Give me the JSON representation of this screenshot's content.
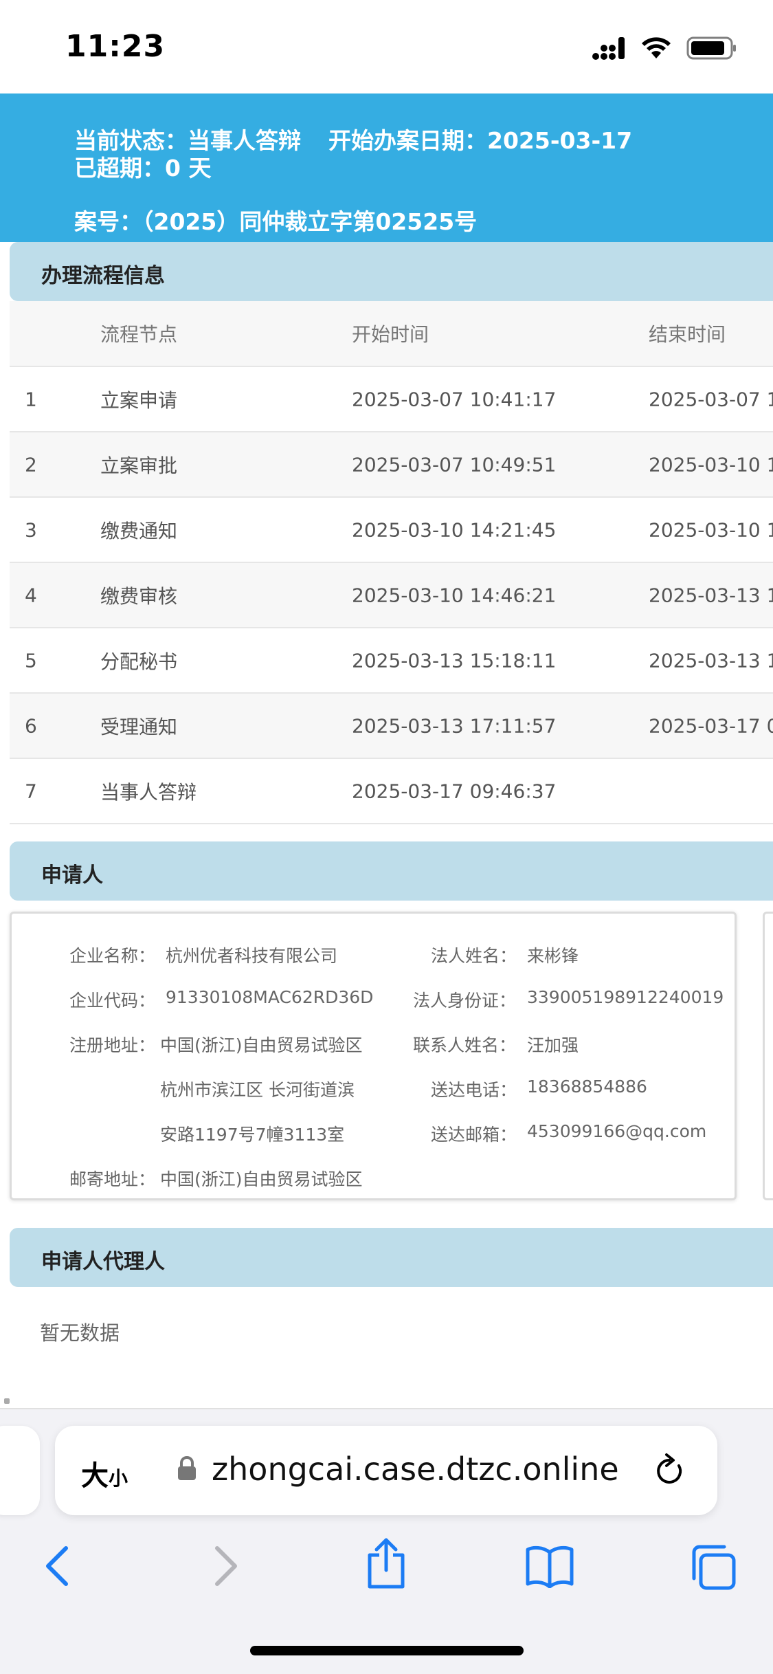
{
  "status_bar": {
    "time": "11:23"
  },
  "header": {
    "status_label": "当前状态：",
    "status_value": "当事人答辩",
    "start_label": "开始办案日期：",
    "start_value": "2025-03-17",
    "overdue_label": "已超期：",
    "overdue_value": "0 天",
    "case_label": "案号：",
    "case_value": "（2025）同仲裁立字第02525号"
  },
  "process": {
    "title": "办理流程信息",
    "columns": [
      "",
      "流程节点",
      "开始时间",
      "结束时间"
    ],
    "rows": [
      {
        "no": "1",
        "node": "立案申请",
        "start": "2025-03-07 10:41:17",
        "end": "2025-03-07 1"
      },
      {
        "no": "2",
        "node": "立案审批",
        "start": "2025-03-07 10:49:51",
        "end": "2025-03-10 1"
      },
      {
        "no": "3",
        "node": "缴费通知",
        "start": "2025-03-10 14:21:45",
        "end": "2025-03-10 1"
      },
      {
        "no": "4",
        "node": "缴费审核",
        "start": "2025-03-10 14:46:21",
        "end": "2025-03-13 1"
      },
      {
        "no": "5",
        "node": "分配秘书",
        "start": "2025-03-13 15:18:11",
        "end": "2025-03-13 1"
      },
      {
        "no": "6",
        "node": "受理通知",
        "start": "2025-03-13 17:11:57",
        "end": "2025-03-17 0"
      },
      {
        "no": "7",
        "node": "当事人答辩",
        "start": "2025-03-17 09:46:37",
        "end": ""
      }
    ]
  },
  "applicant": {
    "title": "申请人",
    "company_name_label": "企业名称：",
    "company_name": "杭州优者科技有限公司",
    "company_code_label": "企业代码：",
    "company_code": "91330108MAC62RD36D",
    "reg_address_label": "注册地址：",
    "reg_address_line1": "中国(浙江)自由贸易试验区",
    "reg_address_line2": "杭州市滨江区 长河街道滨",
    "reg_address_line3": "安路1197号7幢3113室",
    "mail_address_label": "邮寄地址：",
    "mail_address": "中国(浙江)自由贸易试验区",
    "legal_name_label": "法人姓名：",
    "legal_name": "来彬锋",
    "legal_id_label": "法人身份证：",
    "legal_id": "339005198912240019",
    "contact_label": "联系人姓名：",
    "contact": "汪加强",
    "phone_label": "送达电话：",
    "phone": "18368854886",
    "email_label": "送达邮箱：",
    "email": "453099166@qq.com"
  },
  "agent": {
    "title": "申请人代理人",
    "empty_text": "暂无数据"
  },
  "browser": {
    "text_size_big": "大",
    "text_size_small": "小",
    "url": "zhongcai.case.dtzc.online"
  },
  "colors": {
    "header_bg": "#35ADE2",
    "section_bg": "#BEDDEA",
    "ios_blue": "#1C7CF4"
  }
}
